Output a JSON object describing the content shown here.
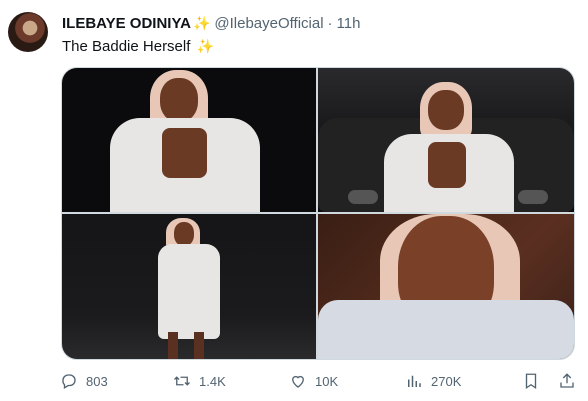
{
  "tweet": {
    "author_name": "ILEBAYE ODINIYA",
    "author_emoji": "✨",
    "handle": "@IlebayeOfficial",
    "separator": "·",
    "time": "11h",
    "text": "The Baddie Herself",
    "text_emoji": "✨"
  },
  "media": {
    "photos": [
      {
        "alt": "photo-1"
      },
      {
        "alt": "photo-2"
      },
      {
        "alt": "photo-3"
      },
      {
        "alt": "photo-4"
      }
    ]
  },
  "actions": {
    "replies": "803",
    "retweets": "1.4K",
    "likes": "10K",
    "views": "270K"
  },
  "icons": [
    "reply-icon",
    "retweet-icon",
    "like-icon",
    "views-icon",
    "bookmark-icon",
    "share-icon"
  ],
  "colors": {
    "text": "#0f1419",
    "secondary": "#536471",
    "border": "#cfd9de"
  }
}
